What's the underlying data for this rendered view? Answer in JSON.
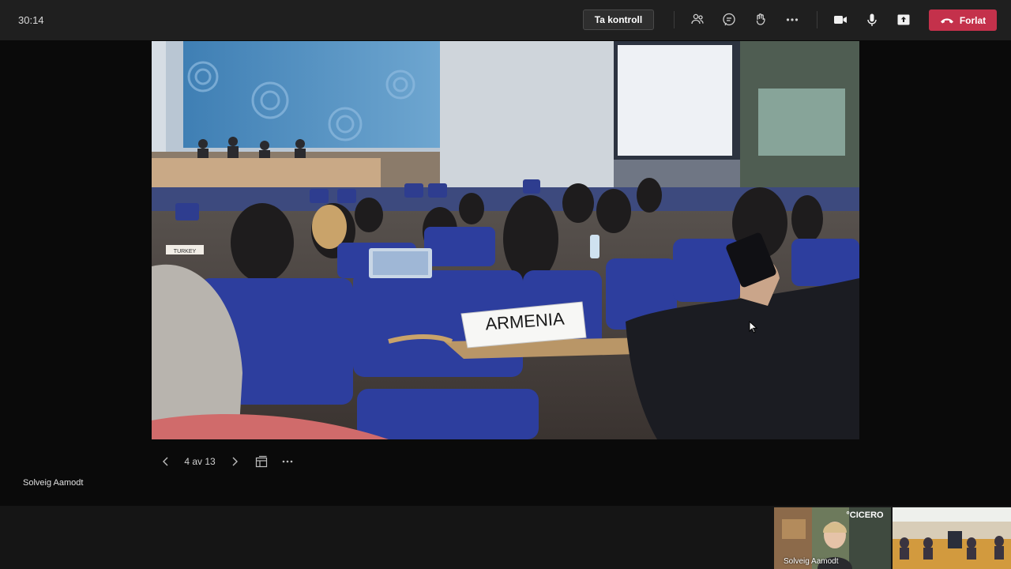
{
  "topbar": {
    "timer": "30:14",
    "take_control_label": "Ta kontroll",
    "icons": [
      "participants-icon",
      "chat-icon",
      "reactions-icon",
      "more-icon",
      "camera-icon",
      "mic-icon",
      "share-icon"
    ],
    "leave_label": "Forlat",
    "leave_color": "#c4314b"
  },
  "stage": {
    "nameplate_text": "ARMENIA",
    "small_plate_text": "TURKEY"
  },
  "slide_controls": {
    "counter": "4 av 13",
    "icons": [
      "chevron-left-icon",
      "chevron-right-icon",
      "grid-icon",
      "more-icon"
    ]
  },
  "presenter": {
    "name": "Solveig Aamodt"
  },
  "thumbnails": [
    {
      "name": "Solveig Aamodt",
      "logo_text": "°CICERO"
    },
    {
      "name": ""
    }
  ]
}
